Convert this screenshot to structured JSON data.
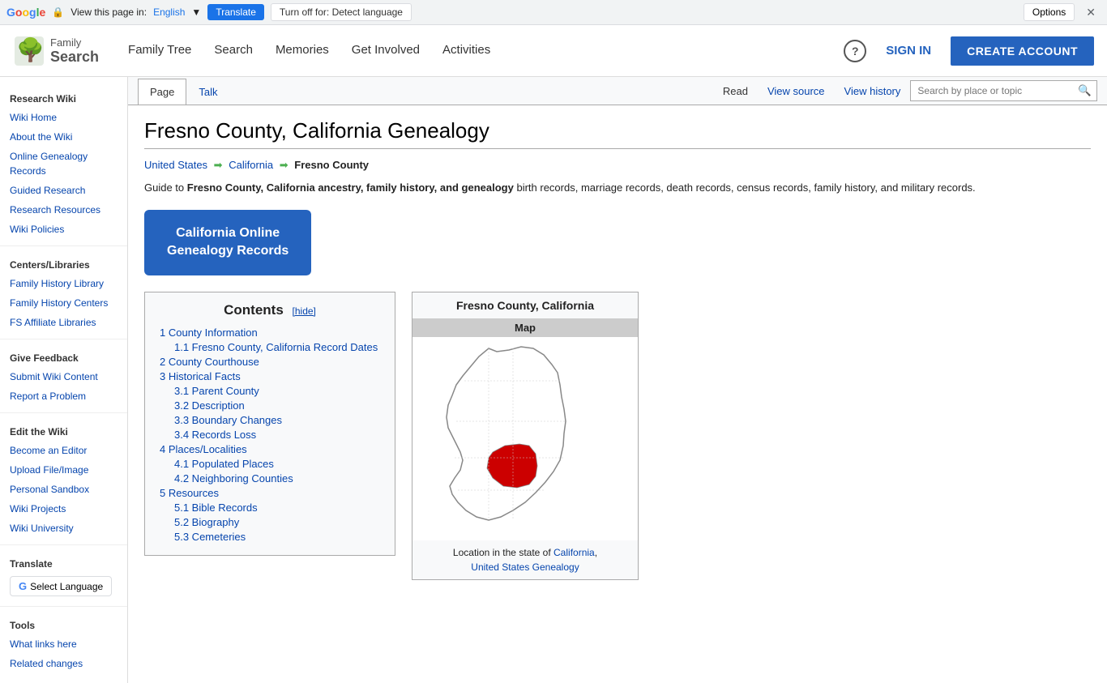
{
  "translate_bar": {
    "label": "View this page in:",
    "language": "English",
    "translate_btn": "Translate",
    "turnoff_btn": "Turn off for: Detect language",
    "options_btn": "Options",
    "close_btn": "✕"
  },
  "header": {
    "logo_family": "Family",
    "logo_search": "Search",
    "nav": [
      {
        "label": "Family Tree",
        "href": "#"
      },
      {
        "label": "Search",
        "href": "#"
      },
      {
        "label": "Memories",
        "href": "#"
      },
      {
        "label": "Get Involved",
        "href": "#"
      },
      {
        "label": "Activities",
        "href": "#"
      }
    ],
    "sign_in": "SIGN IN",
    "create_account": "CREATE ACCOUNT"
  },
  "sidebar": {
    "section1_title": "Research Wiki",
    "links1": [
      {
        "label": "Wiki Home",
        "href": "#"
      },
      {
        "label": "About the Wiki",
        "href": "#"
      },
      {
        "label": "Online Genealogy Records",
        "href": "#"
      },
      {
        "label": "Guided Research",
        "href": "#"
      },
      {
        "label": "Research Resources",
        "href": "#"
      },
      {
        "label": "Wiki Policies",
        "href": "#"
      }
    ],
    "section2_title": "Centers/Libraries",
    "links2": [
      {
        "label": "Family History Library",
        "href": "#"
      },
      {
        "label": "Family History Centers",
        "href": "#"
      },
      {
        "label": "FS Affiliate Libraries",
        "href": "#"
      }
    ],
    "section3_title": "Give Feedback",
    "links3": [
      {
        "label": "Submit Wiki Content",
        "href": "#"
      },
      {
        "label": "Report a Problem",
        "href": "#"
      }
    ],
    "section4_title": "Edit the Wiki",
    "links4": [
      {
        "label": "Become an Editor",
        "href": "#"
      },
      {
        "label": "Upload File/Image",
        "href": "#"
      },
      {
        "label": "Personal Sandbox",
        "href": "#"
      },
      {
        "label": "Wiki Projects",
        "href": "#"
      },
      {
        "label": "Wiki University",
        "href": "#"
      }
    ],
    "section5_title": "Translate",
    "select_language": "Select Language",
    "section6_title": "Tools",
    "links6": [
      {
        "label": "What links here",
        "href": "#"
      },
      {
        "label": "Related changes",
        "href": "#"
      }
    ]
  },
  "page_tabs": {
    "tab_page": "Page",
    "tab_talk": "Talk",
    "action_read": "Read",
    "action_view_source": "View source",
    "action_view_history": "View history",
    "search_placeholder": "Search by place or topic"
  },
  "main": {
    "title": "Fresno County, California Genealogy",
    "breadcrumb": {
      "us": "United States",
      "state": "California",
      "county": "Fresno County"
    },
    "intro": "Guide to ",
    "intro_bold": "Fresno County, California ancestry, family history, and genealogy",
    "intro_rest": " birth records, marriage records, death records, census records, family history, and military records.",
    "ca_records_btn_line1": "California Online",
    "ca_records_btn_line2": "Genealogy Records",
    "contents": {
      "title": "Contents",
      "hide_label": "[hide]",
      "items": [
        {
          "num": "1",
          "label": "County Information",
          "level": 0
        },
        {
          "num": "1.1",
          "label": "Fresno County, California Record Dates",
          "level": 1
        },
        {
          "num": "2",
          "label": "County Courthouse",
          "level": 0
        },
        {
          "num": "3",
          "label": "Historical Facts",
          "level": 0
        },
        {
          "num": "3.1",
          "label": "Parent County",
          "level": 1
        },
        {
          "num": "3.2",
          "label": "Description",
          "level": 1
        },
        {
          "num": "3.3",
          "label": "Boundary Changes",
          "level": 1
        },
        {
          "num": "3.4",
          "label": "Records Loss",
          "level": 1
        },
        {
          "num": "4",
          "label": "Places/Localities",
          "level": 0
        },
        {
          "num": "4.1",
          "label": "Populated Places",
          "level": 1
        },
        {
          "num": "4.2",
          "label": "Neighboring Counties",
          "level": 1
        },
        {
          "num": "5",
          "label": "Resources",
          "level": 0
        },
        {
          "num": "5.1",
          "label": "Bible Records",
          "level": 1
        },
        {
          "num": "5.2",
          "label": "Biography",
          "level": 1
        },
        {
          "num": "5.3",
          "label": "Cemeteries",
          "level": 1
        }
      ]
    },
    "map": {
      "title": "Fresno County, California",
      "subtitle": "Map",
      "caption_text": "Location in the state of ",
      "caption_link1": "California",
      "caption_mid": ", ",
      "caption_link2": "United States Genealogy"
    }
  }
}
